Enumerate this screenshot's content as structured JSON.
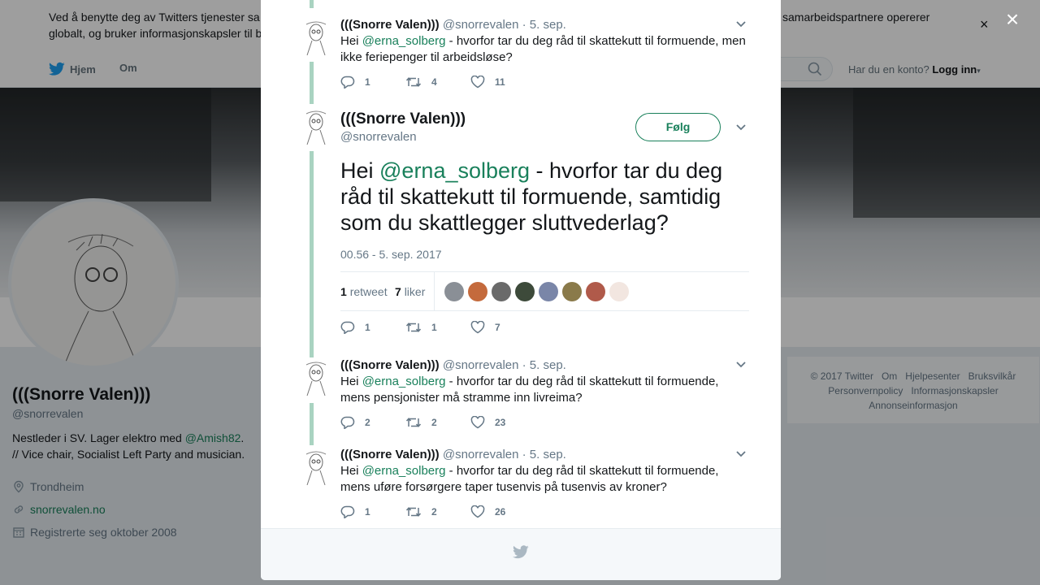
{
  "cookie": {
    "text_left": "Ved å benytte deg av Twitters tjenester sa globalt, og bruker informasjonskapsler til b",
    "text_right": "samarbeidspartnere opererer",
    "close": "×"
  },
  "nav": {
    "home": "Hjem",
    "about": "Om",
    "account_prompt": "Har du en konto?",
    "login": "Logg inn"
  },
  "profile": {
    "name": "(((Snorre Valen)))",
    "handle": "@snorrevalen",
    "bio_before": "Nestleder i SV. Lager elektro med ",
    "bio_mention": "@Amish82",
    "bio_after": ". // Vice chair, Socialist Left Party and musician.",
    "location": "Trondheim",
    "website": "snorrevalen.no",
    "joined": "Registrerte seg oktober 2008"
  },
  "footer_links": [
    "© 2017 Twitter",
    "Om",
    "Hjelpesenter",
    "Bruksvilkår",
    "Personvernpolicy",
    "Informasjonskapsler",
    "Annonseinformasjon"
  ],
  "overlay_close": "×",
  "modal": {
    "tweet_prev": {
      "name": "(((Snorre Valen)))",
      "handle": "@snorrevalen",
      "date": "· 5. sep.",
      "text_before": "Hei ",
      "mention": "@erna_solberg",
      "text_after": " - hvorfor tar du deg råd til skattekutt til formuende, men ikke feriepenger til arbeidsløse?",
      "replies": "1",
      "retweets": "4",
      "likes": "11"
    },
    "main": {
      "name": "(((Snorre Valen)))",
      "handle": "@snorrevalen",
      "follow": "Følg",
      "text_before": "Hei ",
      "mention": "@erna_solberg",
      "text_after": " - hvorfor tar du deg råd til skattekutt til formuende, samtidig som du skattlegger sluttvederlag?",
      "timestamp": "00.56 - 5. sep. 2017",
      "retweet_count": "1",
      "retweet_label": "retweet",
      "like_count": "7",
      "like_label": "liker",
      "liker_colors": [
        "#8a8f96",
        "#c46a3c",
        "#6a6a6a",
        "#3d4a3a",
        "#7a86a8",
        "#8a7a4a",
        "#b05a4a",
        "#f2e6e0"
      ],
      "replies": "1",
      "retweets": "1",
      "likes": "7"
    },
    "reply1": {
      "name": "(((Snorre Valen)))",
      "handle": "@snorrevalen",
      "date": "· 5. sep.",
      "text_before": "Hei ",
      "mention": "@erna_solberg",
      "text_after": " - hvorfor tar du deg råd til skattekutt til formuende, mens pensjonister må stramme inn livreima?",
      "replies": "2",
      "retweets": "2",
      "likes": "23"
    },
    "reply2": {
      "name": "(((Snorre Valen)))",
      "handle": "@snorrevalen",
      "date": "· 5. sep.",
      "text_before": "Hei ",
      "mention": "@erna_solberg",
      "text_after": " - hvorfor tar du deg råd til skattekutt til formuende, mens uføre forsørgere taper tusenvis på tusenvis av kroner?",
      "replies": "1",
      "retweets": "2",
      "likes": "26"
    }
  },
  "colors": {
    "accent": "#19805b",
    "thread_line": "#a9d3c1",
    "twitter_blue": "#1da1f2",
    "muted": "#657786"
  }
}
